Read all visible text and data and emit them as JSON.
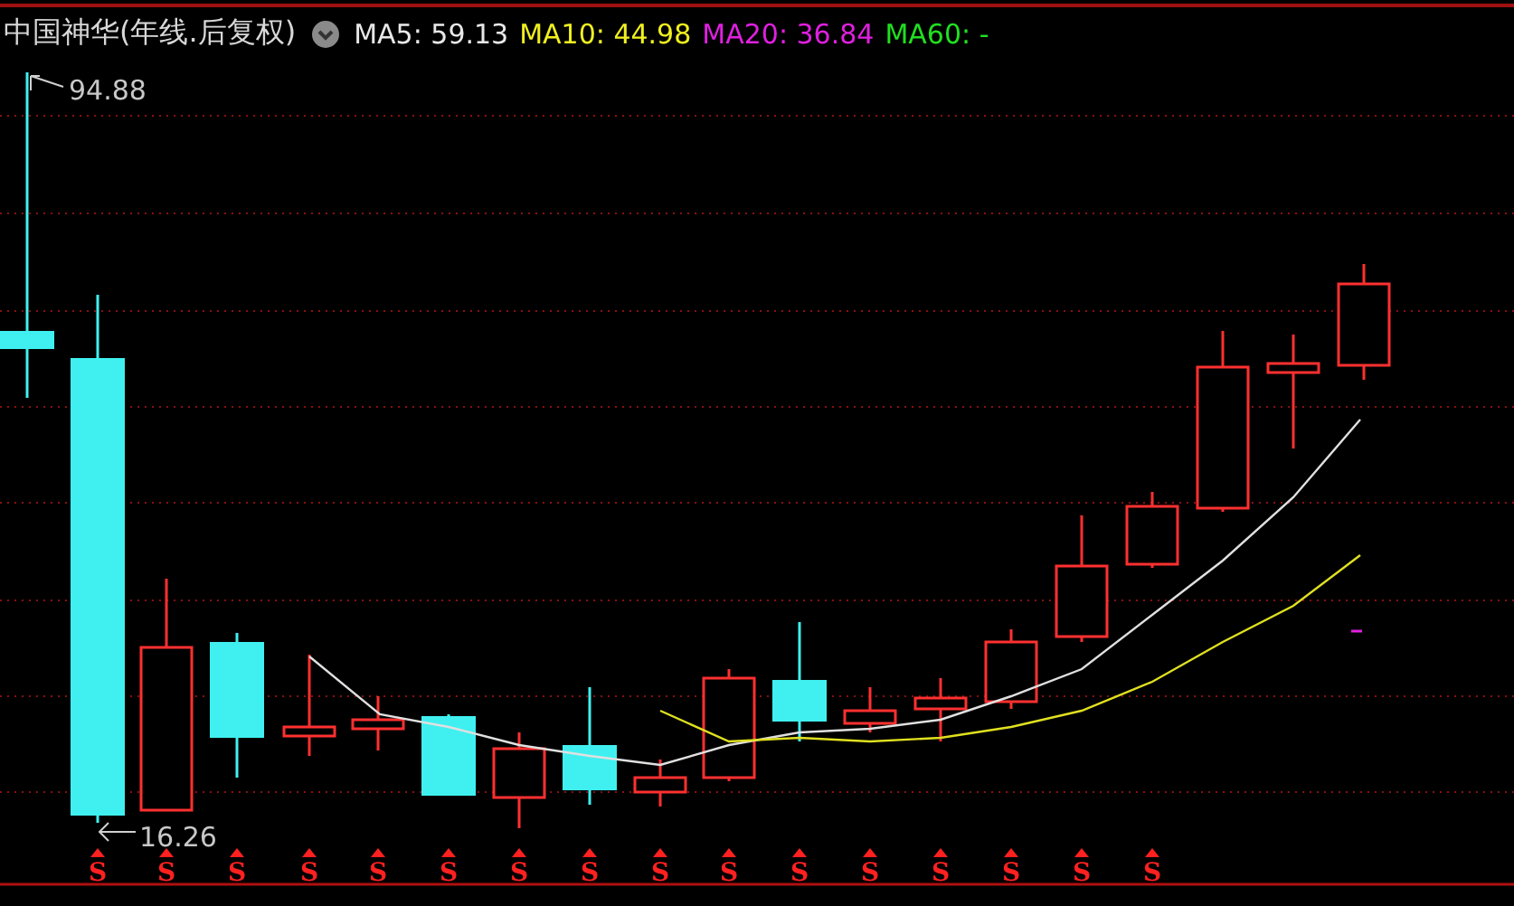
{
  "chart_title": "中国神华(年线.后复权)",
  "moving_averages": [
    {
      "label": "MA5: 59.13",
      "color": "#e8e8e8"
    },
    {
      "label": "MA10: 44.98",
      "color": "#f0f020"
    },
    {
      "label": "MA20: 36.84",
      "color": "#e020e0"
    },
    {
      "label": "MA60: -",
      "color": "#20e020"
    }
  ],
  "max_label": "94.88",
  "min_label": "16.26",
  "signals": [
    "S",
    "S",
    "S",
    "S",
    "S",
    "S",
    "S",
    "S",
    "S",
    "S",
    "S",
    "S",
    "S",
    "S",
    "S",
    "S"
  ]
}
